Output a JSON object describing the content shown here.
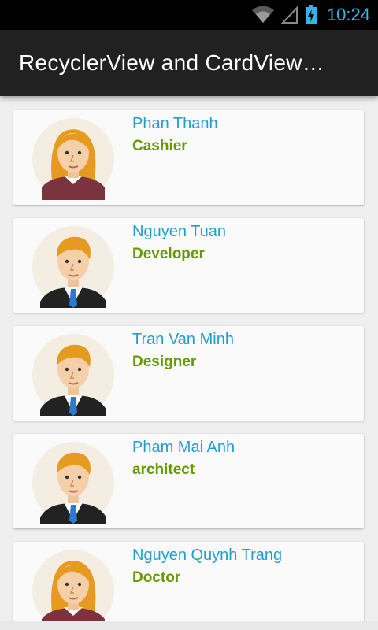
{
  "status_bar": {
    "time": "10:24",
    "icons": [
      "wifi-icon",
      "signal-icon",
      "battery-charging-icon"
    ],
    "accent_color": "#33b5e5"
  },
  "app_bar": {
    "title": "RecyclerView and CardView…",
    "background": "#212121"
  },
  "people": [
    {
      "name": "Phan Thanh",
      "role": "Cashier",
      "avatar": "female-avatar-icon"
    },
    {
      "name": "Nguyen Tuan",
      "role": "Developer",
      "avatar": "male-avatar-icon"
    },
    {
      "name": "Tran Van Minh",
      "role": "Designer",
      "avatar": "male-avatar-icon"
    },
    {
      "name": "Pham Mai Anh",
      "role": "architect",
      "avatar": "male-avatar-icon"
    },
    {
      "name": "Nguyen Quynh Trang",
      "role": "Doctor",
      "avatar": "female-avatar-icon"
    }
  ],
  "colors": {
    "name": "#1e9fd2",
    "role": "#669900",
    "card": "#fafafa",
    "background": "#efefef"
  }
}
